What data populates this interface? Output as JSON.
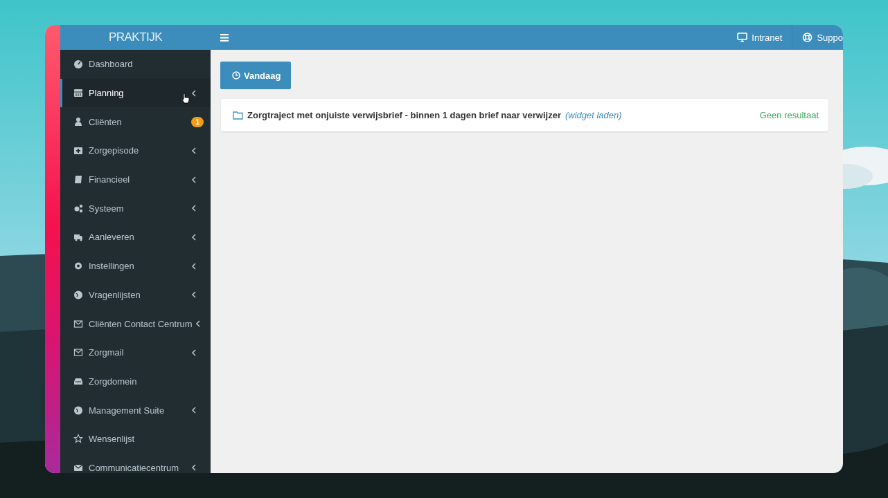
{
  "sidebar": {
    "logo": "PRAKTIJK",
    "items": [
      {
        "label": "Dashboard",
        "selected": false,
        "expandable": false
      },
      {
        "label": "Planning",
        "selected": true,
        "expandable": true
      },
      {
        "label": "Cliënten",
        "selected": false,
        "expandable": false,
        "badge": "1"
      },
      {
        "label": "Zorgepisode",
        "selected": false,
        "expandable": true
      },
      {
        "label": "Financieel",
        "selected": false,
        "expandable": true
      },
      {
        "label": "Systeem",
        "selected": false,
        "expandable": true
      },
      {
        "label": "Aanleveren",
        "selected": false,
        "expandable": true
      },
      {
        "label": "Instellingen",
        "selected": false,
        "expandable": true
      },
      {
        "label": "Vragenlijsten",
        "selected": false,
        "expandable": true
      },
      {
        "label": "Cliënten Contact Centrum",
        "selected": false,
        "expandable": true
      },
      {
        "label": "Zorgmail",
        "selected": false,
        "expandable": true
      },
      {
        "label": "Zorgdomein",
        "selected": false,
        "expandable": false
      },
      {
        "label": "Management Suite",
        "selected": false,
        "expandable": true
      },
      {
        "label": "Wensenlijst",
        "selected": false,
        "expandable": false
      },
      {
        "label": "Communicatiecentrum",
        "selected": false,
        "expandable": true
      }
    ]
  },
  "header": {
    "links": [
      "Intranet",
      "Suppo"
    ]
  },
  "content": {
    "button": "Vandaag",
    "widget": {
      "title": "Zorgtraject met onjuiste verwijsbrief - binnen 1 dagen brief naar verwijzer",
      "link": "(widget laden)",
      "status": "Geen resultaat"
    }
  }
}
